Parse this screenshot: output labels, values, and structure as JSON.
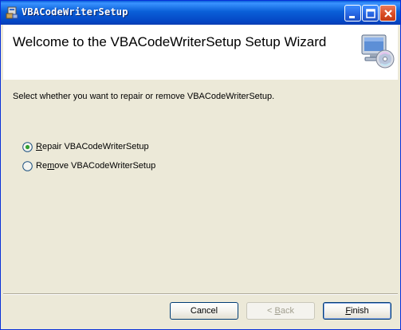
{
  "window": {
    "title": "VBACodeWriterSetup",
    "colors": {
      "titlebar": "#0a5fd8",
      "background": "#ece9d8",
      "close_button": "#d74a22"
    }
  },
  "header": {
    "title": "Welcome to the VBACodeWriterSetup Setup Wizard",
    "icon": "computer-cd-icon"
  },
  "body": {
    "instruction": "Select whether you want to repair or remove VBACodeWriterSetup.",
    "options": [
      {
        "prefix": "",
        "accel": "R",
        "rest": "epair VBACodeWriterSetup",
        "selected": true
      },
      {
        "prefix": "Re",
        "accel": "m",
        "rest": "ove VBACodeWriterSetup",
        "selected": false
      }
    ]
  },
  "buttons": {
    "cancel": "Cancel",
    "back_arrow": "< ",
    "back_accel": "B",
    "back_rest": "ack",
    "finish_accel": "F",
    "finish_rest": "inish"
  }
}
